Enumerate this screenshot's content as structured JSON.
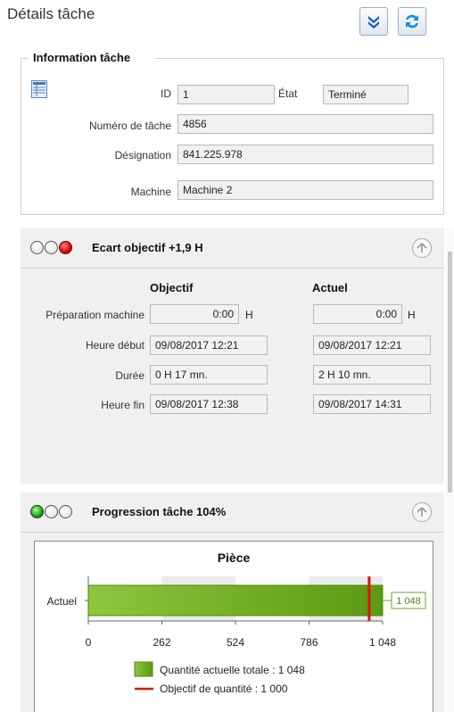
{
  "page": {
    "title": "Détails tâche"
  },
  "toolbar": {
    "expand_icon": "double-chevron-down-icon",
    "refresh_icon": "refresh-arrows-icon"
  },
  "info": {
    "legend": "Information tâche",
    "icon": "document-grid-icon",
    "id_label": "ID",
    "id_value": "1",
    "state_label": "État",
    "state_value": "Terminé",
    "task_number_label": "Numéro de tâche",
    "task_number_value": "4856",
    "designation_label": "Désignation",
    "designation_value": "841.225.978",
    "machine_label": "Machine",
    "machine_value": "Machine 2"
  },
  "gap_section": {
    "title": "Ecart objectif +1,9 H",
    "lamps": [
      "off",
      "off",
      "red"
    ],
    "collapse_icon": "circle-arrow-up-icon",
    "col_objective": "Objectif",
    "col_actual": "Actuel",
    "rows": [
      {
        "label": "Préparation machine",
        "objective": "0:00",
        "actual": "0:00",
        "unit": "H"
      },
      {
        "label": "Heure début",
        "objective": "09/08/2017 12:21",
        "actual": "09/08/2017 12:21"
      },
      {
        "label": "Durée",
        "objective": "0 H 17 mn.",
        "actual": "2 H 10 mn."
      },
      {
        "label": "Heure fin",
        "objective": "09/08/2017 12:38",
        "actual": "09/08/2017 14:31"
      }
    ]
  },
  "progress_section": {
    "title": "Progression tâche 104%",
    "lamps": [
      "green",
      "off",
      "off"
    ],
    "collapse_icon": "circle-arrow-up-icon"
  },
  "colors": {
    "bar_green": "#6aa91e",
    "target_red": "#e01010",
    "label_box_green": "#6aa91e"
  },
  "chart_data": {
    "type": "bar",
    "orientation": "horizontal",
    "title": "Pièce",
    "categories": [
      "Actuel"
    ],
    "series": [
      {
        "name": "Quantité actuelle totale : 1 048",
        "values": [
          1048
        ]
      }
    ],
    "target": {
      "name": "Objectif de quantité : 1 000",
      "value": 1000
    },
    "data_label": "1 048",
    "xlim": [
      0,
      1048
    ],
    "xticks": [
      0,
      262,
      524,
      786,
      1048
    ],
    "xtick_labels": [
      "0",
      "262",
      "524",
      "786",
      "1 048"
    ],
    "legend_position": "bottom",
    "grid": "alternating bands"
  }
}
